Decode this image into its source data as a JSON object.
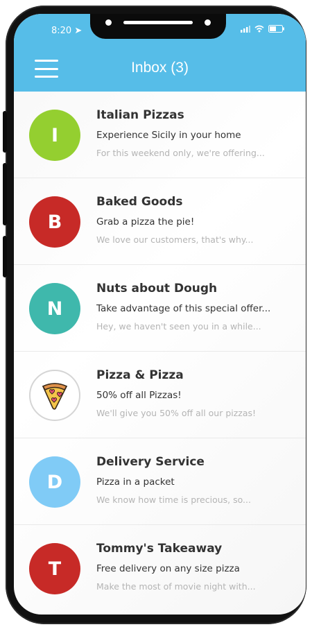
{
  "status": {
    "time": "8:20"
  },
  "header": {
    "title": "Inbox (3)"
  },
  "colors": {
    "header": "#56bde8"
  },
  "messages": [
    {
      "initial": "I",
      "avatar_color": "#94cf30",
      "sender": "Italian Pizzas",
      "subject": "Experience Sicily in your home",
      "preview": "For this weekend only, we're offering..."
    },
    {
      "initial": "B",
      "avatar_color": "#c72a27",
      "sender": "Baked Goods",
      "subject": "Grab a pizza the pie!",
      "preview": "We love our customers, that's why..."
    },
    {
      "initial": "N",
      "avatar_color": "#3fb8ac",
      "sender": "Nuts about Dough",
      "subject": "Take advantage of this special offer...",
      "preview": "Hey, we haven't seen you in a while..."
    },
    {
      "initial": "",
      "avatar_icon": "pizza-slice-icon",
      "sender": "Pizza & Pizza",
      "subject": "50% off all Pizzas!",
      "preview": "We'll give you 50% off all our pizzas!"
    },
    {
      "initial": "D",
      "avatar_color": "#80cbf6",
      "sender": "Delivery Service",
      "subject": "Pizza in a packet",
      "preview": "We know how time is precious, so..."
    },
    {
      "initial": "T",
      "avatar_color": "#c72a27",
      "sender": "Tommy's Takeaway",
      "subject": "Free delivery on any size pizza",
      "preview": "Make the most of movie night with..."
    }
  ]
}
